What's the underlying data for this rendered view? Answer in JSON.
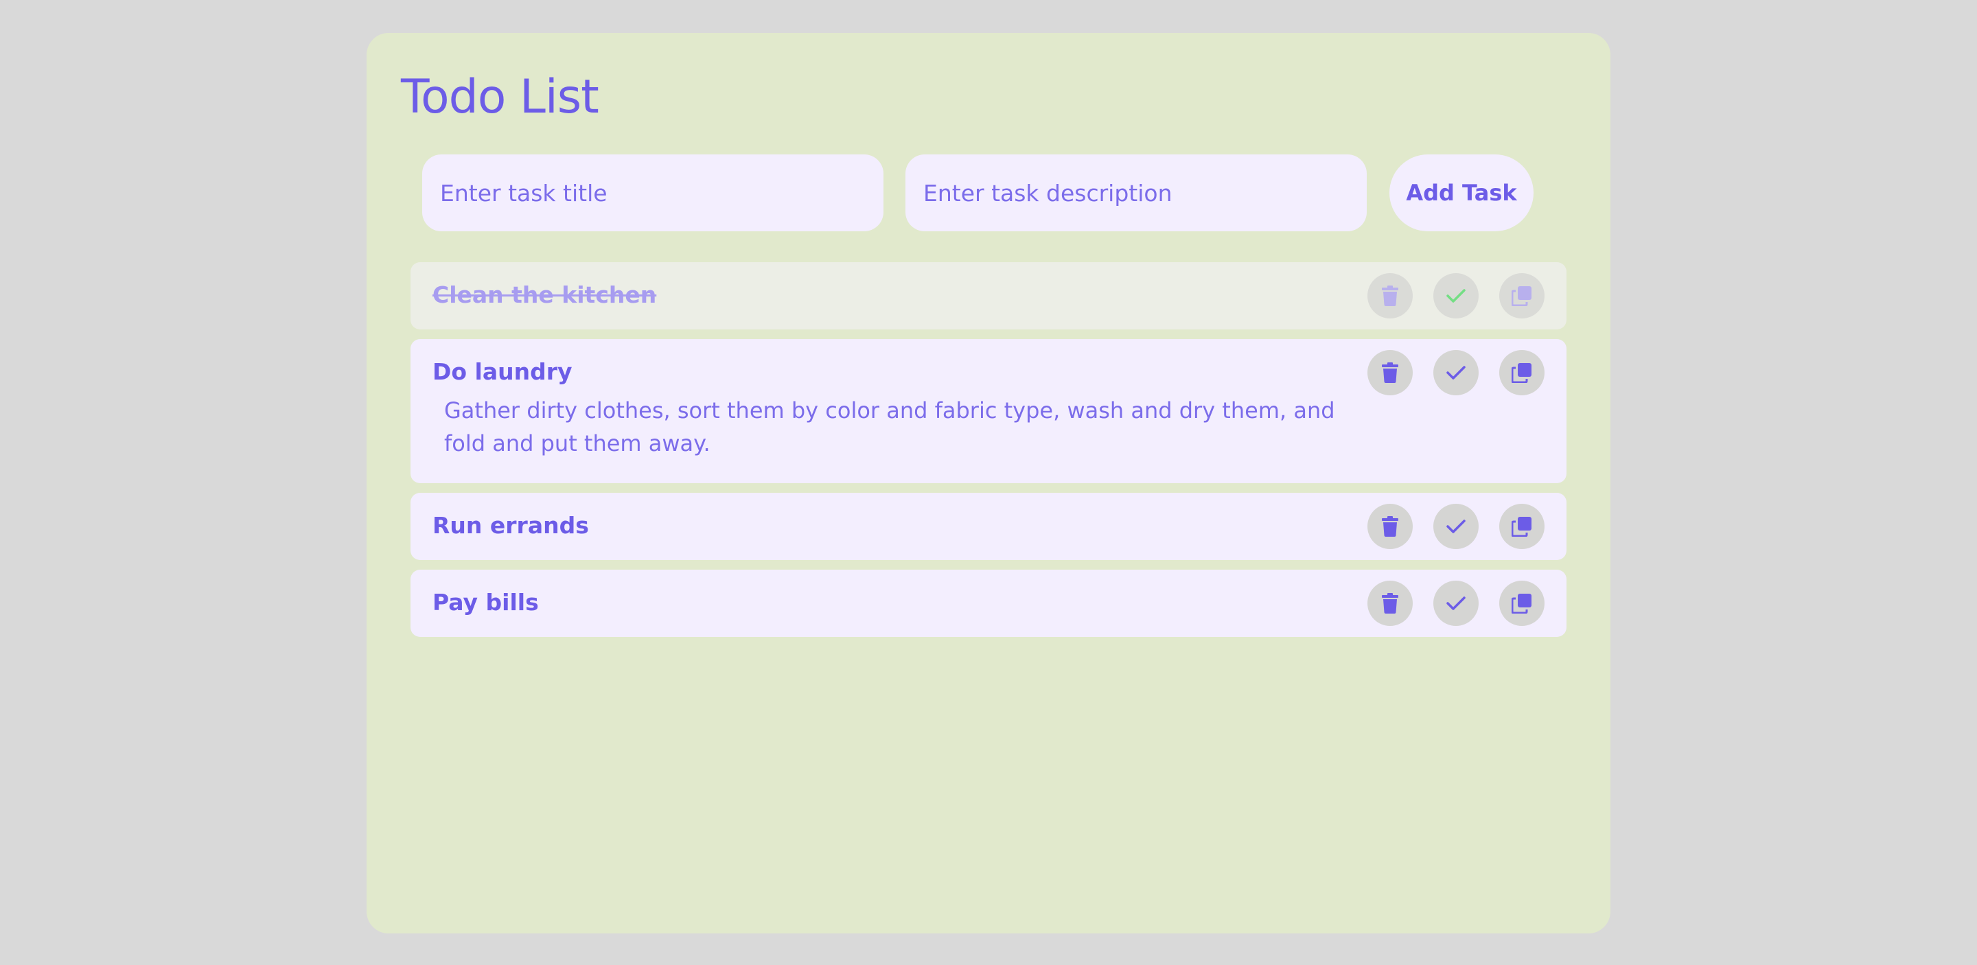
{
  "app": {
    "title": "Todo List"
  },
  "form": {
    "title_placeholder": "Enter task title",
    "description_placeholder": "Enter task description",
    "add_button_label": "Add Task"
  },
  "tasks": [
    {
      "title": "Clean the kitchen",
      "description": "",
      "completed": true
    },
    {
      "title": "Do laundry",
      "description": "Gather dirty clothes, sort them by color and fabric type, wash and dry them, and fold and put them away.",
      "completed": false
    },
    {
      "title": "Run errands",
      "description": "",
      "completed": false
    },
    {
      "title": "Pay bills",
      "description": "",
      "completed": false
    }
  ],
  "icons": {
    "delete": "trash-icon",
    "complete": "check-icon",
    "duplicate": "copy-icon"
  },
  "colors": {
    "page_background": "#d9d9d9",
    "card_background": "#e1e9cc",
    "accent": "#6c5ce7",
    "item_background": "#f3eefe",
    "completed_item_background": "#eceee6",
    "completed_check": "#4cd964",
    "action_button_background": "#d5d5d3"
  }
}
